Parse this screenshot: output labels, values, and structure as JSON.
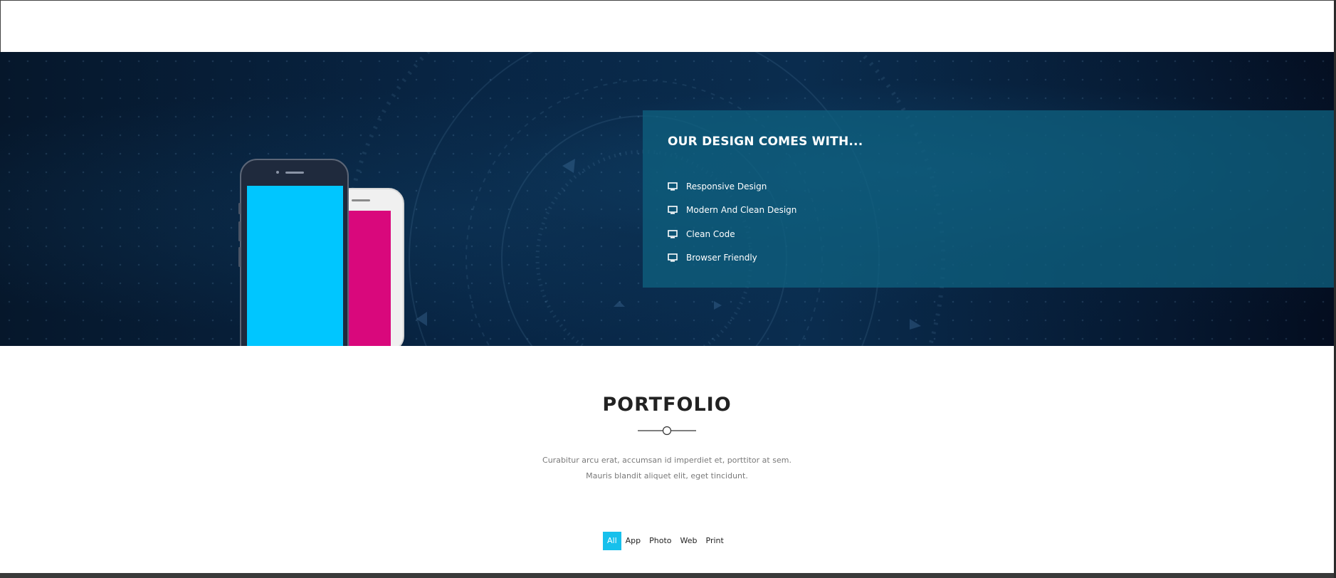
{
  "design_section": {
    "title": "OUR DESIGN COMES WITH...",
    "features": [
      {
        "label": "Responsive Design",
        "icon": "monitor-icon"
      },
      {
        "label": "Modern And Clean Design",
        "icon": "monitor-icon"
      },
      {
        "label": "Clean Code",
        "icon": "monitor-icon"
      },
      {
        "label": "Browser Friendly",
        "icon": "monitor-icon"
      }
    ]
  },
  "portfolio": {
    "title": "PORTFOLIO",
    "description": "Curabitur arcu erat, accumsan id imperdiet et, porttitor at sem. Mauris blandit aliquet elit, eget tincidunt.",
    "filters": [
      {
        "label": "All",
        "active": true
      },
      {
        "label": "App",
        "active": false
      },
      {
        "label": "Photo",
        "active": false
      },
      {
        "label": "Web",
        "active": false
      },
      {
        "label": "Print",
        "active": false
      }
    ]
  },
  "colors": {
    "accent": "#17c0ec",
    "panel": "#0e5f7d",
    "phone_front_screen": "#00c6ff",
    "phone_back_screen": "#d9087c"
  }
}
